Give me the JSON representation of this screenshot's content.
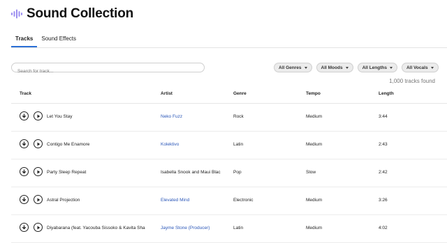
{
  "app": {
    "title": "Sound Collection",
    "logo_icon": "sound-wave-icon",
    "accent_color": "#2a6fd6",
    "logo_color": "#9b8ef0"
  },
  "tabs": [
    {
      "label": "Tracks",
      "active": true
    },
    {
      "label": "Sound Effects",
      "active": false
    }
  ],
  "search": {
    "placeholder": "Search for track..."
  },
  "filters": [
    "All Genres",
    "All Moods",
    "All Lengths",
    "All Vocals"
  ],
  "results_count": "1,000 tracks found",
  "table": {
    "headers": {
      "track": "Track",
      "artist": "Artist",
      "genre": "Genre",
      "tempo": "Tempo",
      "length": "Length"
    },
    "rows": [
      {
        "track": "Let You Stay",
        "artist": "Neko Fuzz",
        "artist_link": true,
        "genre": "Rock",
        "tempo": "Medium",
        "length": "3:44"
      },
      {
        "track": "Contigo Me Enamore",
        "artist": "Kolektivo",
        "artist_link": true,
        "genre": "Latin",
        "tempo": "Medium",
        "length": "2:43"
      },
      {
        "track": "Party Sleep Repeat",
        "artist": "Isabella Snook and Maui Blac",
        "artist_link": false,
        "genre": "Pop",
        "tempo": "Slow",
        "length": "2:42"
      },
      {
        "track": "Astral Projection",
        "artist": "Elevated Mind",
        "artist_link": true,
        "genre": "Electronic",
        "tempo": "Medium",
        "length": "3:26"
      },
      {
        "track": "Diyabarana (feat. Yacouba Sissoko & Kavita Sha",
        "artist": "Jayme Stone (Producer)",
        "artist_link": true,
        "genre": "Latin",
        "tempo": "Medium",
        "length": "4:02"
      }
    ]
  }
}
